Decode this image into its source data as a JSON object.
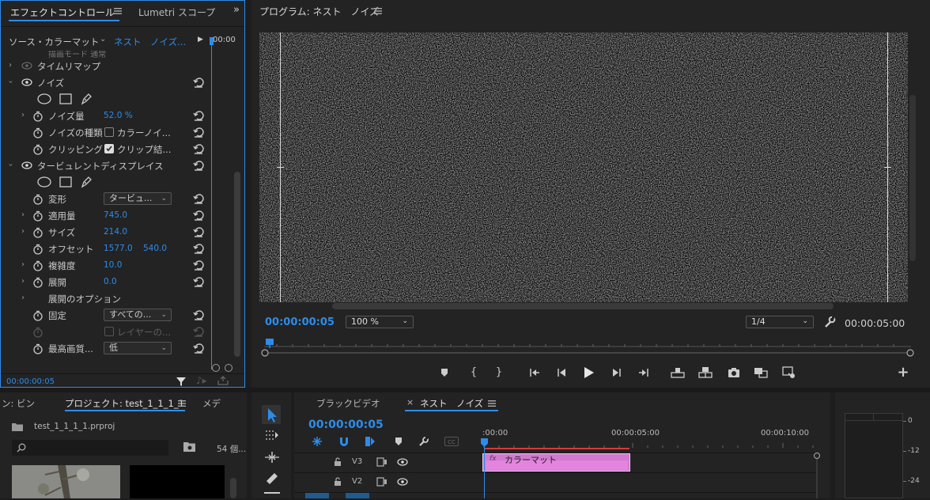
{
  "effect_controls": {
    "tab_active": "エフェクトコントロール",
    "tab_other": "Lumetri スコープ",
    "source_label": "ソース・カラーマット",
    "sequence_label": "ネスト　ノイズ...",
    "header_time": "00:00",
    "clipped_text": "描画モード   通常",
    "rows": {
      "time_remap": "タイムリマップ",
      "noise": "ノイズ",
      "noise_amount": "ノイズ量",
      "noise_amount_value": "52.0 %",
      "noise_type": "ノイズの種類",
      "noise_type_value": "カラーノイ...",
      "clipping": "クリッピング",
      "clipping_value": "クリップ結...",
      "turbulent": "タービュレントディスプレイス",
      "transform": "変形",
      "transform_value": "タービュ...",
      "amount": "適用量",
      "amount_value": "745.0",
      "size": "サイズ",
      "size_value": "214.0",
      "offset": "オフセット",
      "offset_x": "1577.0",
      "offset_y": "540.0",
      "complexity": "複雑度",
      "complexity_value": "10.0",
      "evolution": "展開",
      "evolution_value": "0.0",
      "evolution_options": "展開のオプション",
      "pin": "固定",
      "pin_value": "すべての...",
      "layer_value": "レイヤーの...",
      "quality": "最高画質...",
      "quality_value": "低"
    },
    "footer_time": "00:00:00:05"
  },
  "program_monitor": {
    "title": "プログラム: ネスト　ノイズ",
    "timecode": "00:00:00:05",
    "zoom": "100 %",
    "resolution": "1/4",
    "duration": "00:00:05:00",
    "plus": "+"
  },
  "project": {
    "tab_left": "ン: ビン",
    "tab_active": "プロジェクト: test_1_1_1_1",
    "tab_right": "メデ",
    "file": "test_1_1_1_1.prproj",
    "item_count": "54 個..."
  },
  "timeline": {
    "tab_other": "ブラックビデオ",
    "tab_close": "×",
    "tab_active": "ネスト　ノイズ",
    "timecode": "00:00:00:05",
    "cc": "CC",
    "ruler": [
      ":00:00",
      "00:00:05:00",
      "00:00:10:00"
    ],
    "tracks": [
      "V3",
      "V2"
    ],
    "clip_label": "カラーマット",
    "clip_fx": "fx",
    "clip_color": "#e17fdb"
  },
  "audio_meter": {
    "scale": [
      "0",
      "-12",
      "-24"
    ]
  },
  "colors": {
    "accent": "#2d8ceb",
    "playhead": "#2d8ceb",
    "work_area": "#d9383a"
  }
}
